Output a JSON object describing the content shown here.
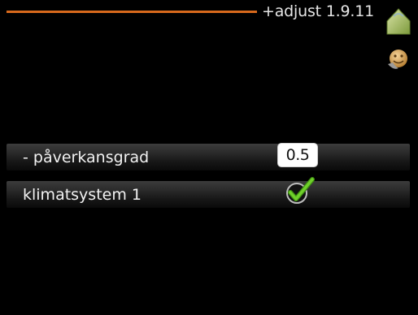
{
  "header": {
    "menu_title": "+adjust 1.9.11",
    "accent_color": "#d8691c",
    "icons": [
      "house-icon",
      "smiley-icon"
    ]
  },
  "rows": [
    {
      "label": "- påverkansgrad",
      "value": "0.5",
      "control": "number-box"
    },
    {
      "label": "klimatsystem 1",
      "checked": true,
      "control": "checkbox",
      "check_color": "#6fcf2a"
    }
  ]
}
